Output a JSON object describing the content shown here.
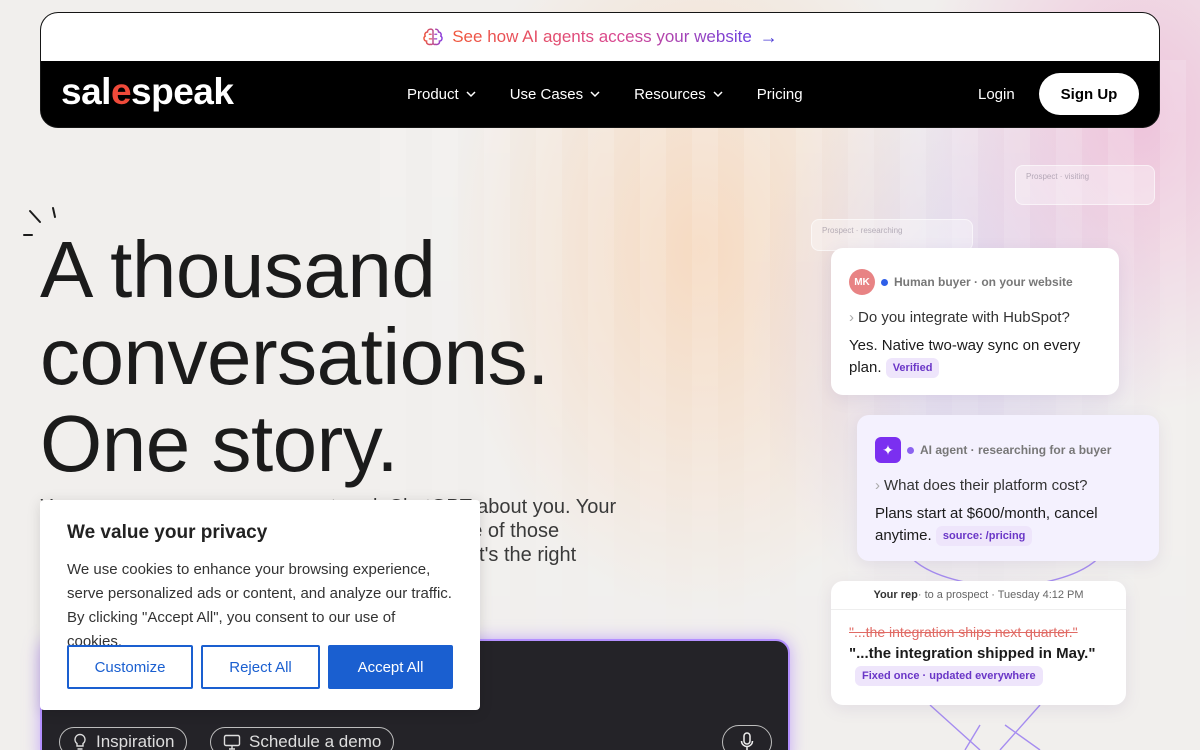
{
  "announcement": {
    "text": "See how AI agents access your website",
    "arrow": "→",
    "icon": "brain-icon"
  },
  "nav": {
    "logo_pre": "sal",
    "logo_accent": "e",
    "logo_post": "speak",
    "items": [
      {
        "label": "Product",
        "has_dropdown": true
      },
      {
        "label": "Use Cases",
        "has_dropdown": true
      },
      {
        "label": "Resources",
        "has_dropdown": true
      },
      {
        "label": "Pricing",
        "has_dropdown": false
      }
    ],
    "login": "Login",
    "signup": "Sign Up"
  },
  "hero": {
    "title_lines": [
      "A thousand",
      "conversations.",
      "One story."
    ],
    "subtitle_lines": [
      "Y                                                  ts ask ChatGPT about you. Your",
      "                                              r machine, every one of those",
      "                                              espeak makes sure it's the right"
    ]
  },
  "chatbox": {
    "chips": [
      {
        "label": "Inspiration",
        "icon": "lightbulb-icon"
      },
      {
        "label": "Schedule a demo",
        "icon": "monitor-icon"
      }
    ],
    "mic_icon": "microphone-icon"
  },
  "cookie": {
    "title": "We value your privacy",
    "body": "We use cookies to enhance your browsing experience, serve personalized ads or content, and analyze our traffic. By clicking \"Accept All\", you consent to our use of cookies.",
    "customize": "Customize",
    "reject": "Reject All",
    "accept": "Accept All"
  },
  "cards": {
    "ghost_1": "Prospect · researching",
    "ghost_2": "Prospect · visiting",
    "human": {
      "avatar": "MK",
      "meta": "Human buyer · on your website",
      "question": "Do you integrate with HubSpot?",
      "answer": "Yes. Native two-way sync on every plan.",
      "tag": "Verified"
    },
    "agent": {
      "icon": "✦",
      "meta": "AI agent · researching for a buyer",
      "question": "What does their platform cost?",
      "answer": "Plans start at $600/month, cancel anytime.",
      "tag": "source: /pricing"
    },
    "rep": {
      "meta_bold": "Your rep",
      "meta_rest": " · to a prospect · Tuesday 4:12 PM",
      "struck": "\"...the integration ships next quarter.\"",
      "corrected": "\"...the integration shipped in May.\"",
      "tag": "Fixed once · updated everywhere"
    }
  },
  "colors": {
    "accent_purple": "#7b2ff0",
    "cookie_blue": "#1a5fd0",
    "brand_red": "#ef4a3a"
  }
}
